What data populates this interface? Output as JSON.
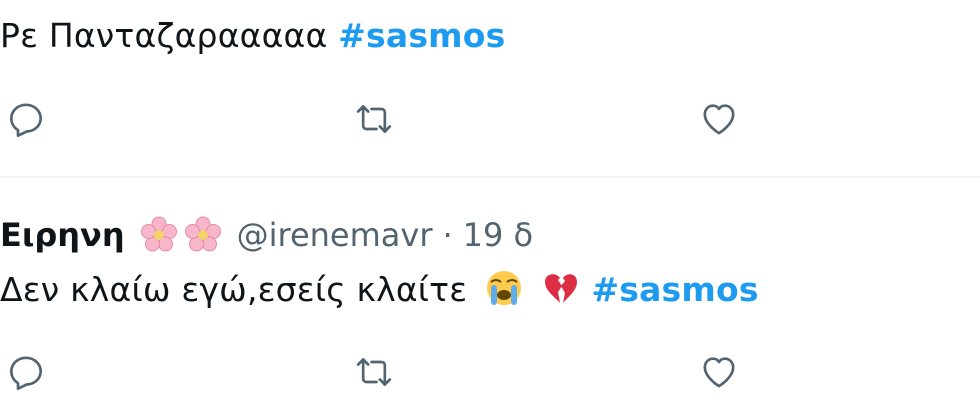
{
  "tweet1": {
    "text": "Ρε Πανταζαρααααα",
    "hashtag": "#sasmos"
  },
  "tweet2": {
    "name": "Ειρηνη",
    "handle": "@irenemavr",
    "separator": "·",
    "time": "19 δ",
    "text": "Δεν κλαίω εγώ,εσείς κλαίτε",
    "hashtag": "#sasmos",
    "emojis": [
      "loudly-crying-face",
      "broken-heart"
    ],
    "name_decorations": [
      "cherry-blossom",
      "cherry-blossom"
    ]
  },
  "colors": {
    "hashtag": "#1d9bf0",
    "icon": "#536471",
    "text": "#0f1419",
    "divider": "#eff3f4"
  },
  "actions": [
    "reply-icon",
    "retweet-icon",
    "like-icon"
  ]
}
